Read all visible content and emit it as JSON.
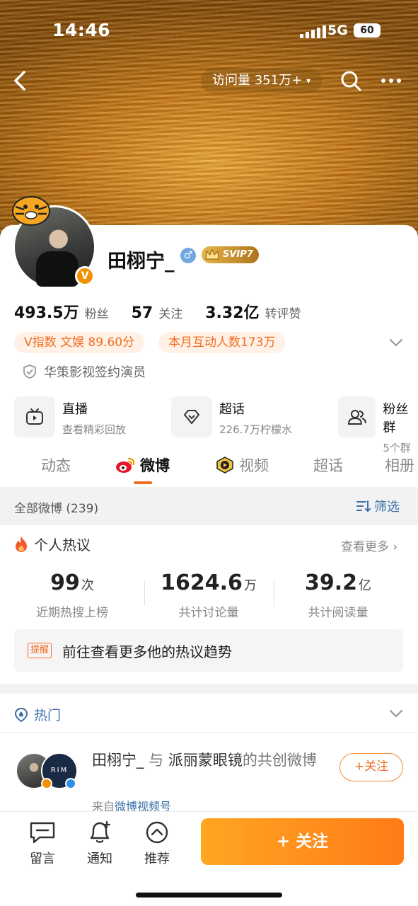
{
  "status": {
    "time": "14:46",
    "network": "5G",
    "battery": "60"
  },
  "header": {
    "visits": "访问量 351万+",
    "dropdown": "▾"
  },
  "profile": {
    "name": "田栩宁_",
    "gender_symbol": "♂",
    "vip_badge": "SVIP7",
    "verify_badge": "V",
    "stats": [
      {
        "value": "493.5万",
        "label": "粉丝"
      },
      {
        "value": "57",
        "label": "关注"
      },
      {
        "value": "3.32亿",
        "label": "转评赞"
      }
    ],
    "tags": [
      "V指数 文娱 89.60分",
      "本月互动人数173万"
    ],
    "verification": "华策影视签约演员"
  },
  "functions": [
    {
      "title": "直播",
      "subtitle": "查看精彩回放",
      "icon": "tv-icon"
    },
    {
      "title": "超话",
      "subtitle": "226.7万柠檬水",
      "icon": "diamond-icon"
    },
    {
      "title": "粉丝群",
      "subtitle": "5个群",
      "icon": "group-icon"
    }
  ],
  "tabs": [
    "动态",
    "微博",
    "视频",
    "超话",
    "相册"
  ],
  "filter": {
    "title": "全部微博 (239)",
    "button": "筛选"
  },
  "hot_discussion": {
    "title": "个人热议",
    "more": "查看更多 ›",
    "metrics": [
      {
        "value": "99",
        "unit": "次",
        "label": "近期热搜上榜"
      },
      {
        "value": "1624.6",
        "unit": "万",
        "label": "共计讨论量"
      },
      {
        "value": "39.2",
        "unit": "亿",
        "label": "共计阅读量"
      }
    ],
    "tip_tag": "提醒",
    "tip_text": "前往查看更多他的热议趋势"
  },
  "hot_section": {
    "title": "热门"
  },
  "post": {
    "author": "田栩宁_",
    "with": " 与 ",
    "partner": "派丽蒙眼镜",
    "suffix": "的共创微博",
    "source_prefix": "来自",
    "source": "微博视频号",
    "partner_avatar_text": "RIM",
    "follow": "+关注"
  },
  "bottom_nav": [
    {
      "label": "留言",
      "icon": "message-icon"
    },
    {
      "label": "通知",
      "icon": "bell-icon"
    },
    {
      "label": "推荐",
      "icon": "recommend-icon"
    }
  ],
  "follow_button": "+ 关注",
  "colors": {
    "accent": "#f26d21",
    "link": "#3e6fa8",
    "follow_gradient": "#ff7b16"
  }
}
